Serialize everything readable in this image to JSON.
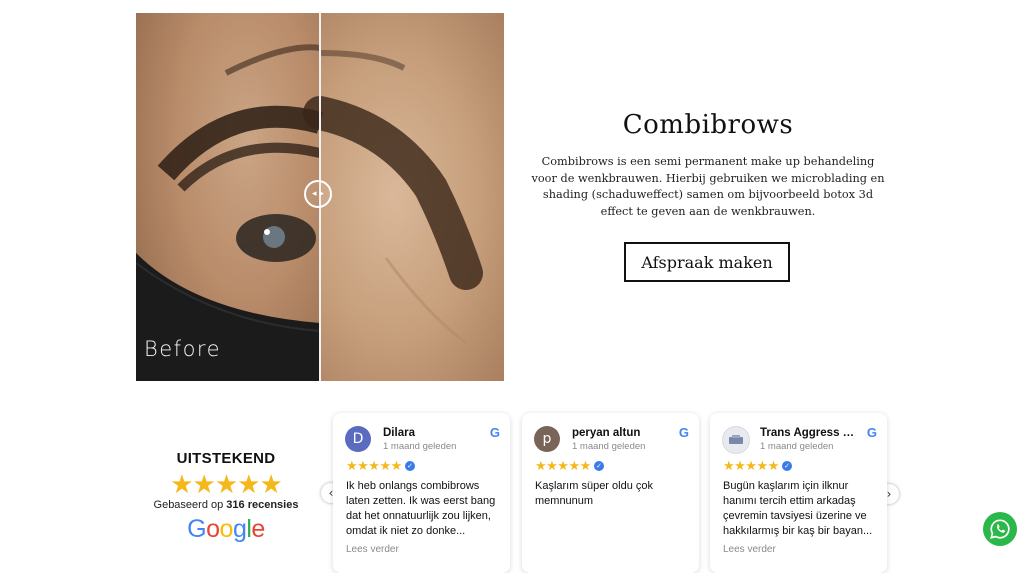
{
  "before_after": {
    "before_label": "Before",
    "handle_glyph": "◂▸"
  },
  "hero": {
    "title": "Combibrows",
    "description": "Combibrows is een semi permanent make up behandeling voor de wenkbrauwen. Hierbij gebruiken we microblading en shading (schaduweffect) samen om bijvoorbeeld botox 3d effect te geven aan de wenkbrauwen.",
    "cta": "Afspraak maken"
  },
  "rating": {
    "title": "UITSTEKEND",
    "stars": "★★★★★",
    "based_prefix": "Gebaseerd op ",
    "count": "316 recensies",
    "logo_letters": [
      "G",
      "o",
      "o",
      "g",
      "l",
      "e"
    ],
    "logo_colors": [
      "#4285F4",
      "#EA4335",
      "#FBBC05",
      "#4285F4",
      "#34A853",
      "#EA4335"
    ]
  },
  "carousel": {
    "prev_glyph": "‹",
    "next_glyph": "›"
  },
  "reviews": [
    {
      "avatar": "D",
      "avatar_color": "#5b6bbf",
      "name": "Dilara",
      "date": "1 maand geleden",
      "stars": "★★★★★",
      "text": "Ik heb onlangs combibrows laten zetten. Ik was eerst bang dat het onnatuurlijk zou lijken, omdat ik niet zo donke...",
      "more": "Lees verder"
    },
    {
      "avatar": "p",
      "avatar_color": "#7a6357",
      "name": "peryan altun",
      "date": "1 maand geleden",
      "stars": "★★★★★",
      "text": "Kaşlarım süper oldu çok memnunum",
      "more": ""
    },
    {
      "avatar": "",
      "avatar_color": "#e8eaf0",
      "name": "Trans Aggress C...",
      "date": "1 maand geleden",
      "stars": "★★★★★",
      "text": "Bugün kaşlarım için ilknur hanımı tercih ettim arkadaş çevremin tavsiyesi üzerine ve hakkılarmış bir kaş bir bayan...",
      "more": "Lees verder"
    }
  ],
  "google_g": "G",
  "verified_glyph": "✓",
  "colors": {
    "star": "#f5b81a",
    "whatsapp": "#2ab84a",
    "verified": "#3a7be8"
  }
}
